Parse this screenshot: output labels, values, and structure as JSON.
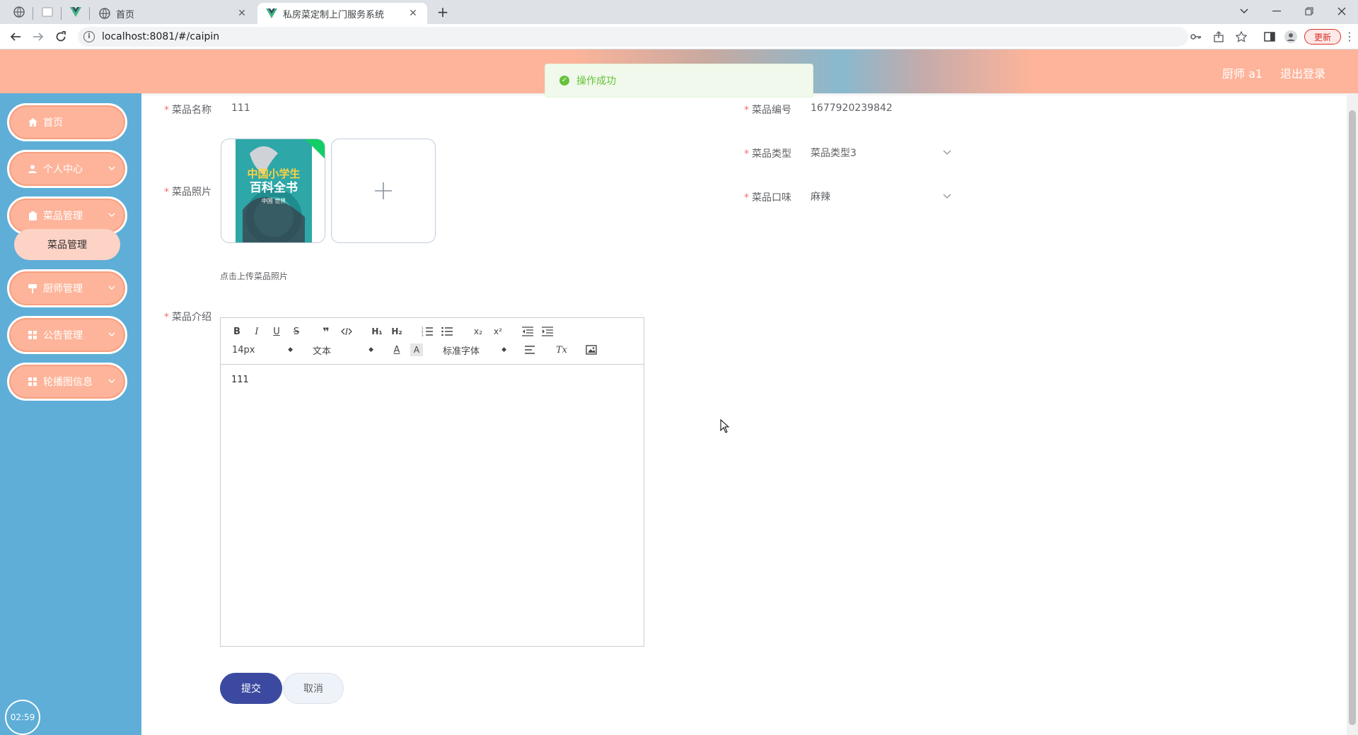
{
  "browser": {
    "tabs": [
      {
        "title": "首页"
      },
      {
        "title": "私房菜定制上门服务系统"
      }
    ],
    "url": "localhost:8081/#/caipin",
    "update_label": "更新"
  },
  "header": {
    "user_label": "厨师 a1",
    "logout_label": "退出登录"
  },
  "toast": {
    "message": "操作成功"
  },
  "sidebar": {
    "items": [
      {
        "label": "首页"
      },
      {
        "label": "个人中心"
      },
      {
        "label": "菜品管理"
      },
      {
        "label": "厨师管理"
      },
      {
        "label": "公告管理"
      },
      {
        "label": "轮播图信息"
      }
    ],
    "submenu": {
      "label": "菜品管理"
    },
    "clock": "02:59"
  },
  "form": {
    "name": {
      "label": "菜品名称",
      "value": "111"
    },
    "code": {
      "label": "菜品编号",
      "value": "1677920239842"
    },
    "type": {
      "label": "菜品类型",
      "value": "菜品类型3"
    },
    "taste": {
      "label": "菜品口味",
      "value": "麻辣"
    },
    "photo": {
      "label": "菜品照片",
      "tip": "点击上传菜品照片",
      "thumb_lines": [
        "中国小学生",
        "百科全书",
        "中国 世界"
      ]
    },
    "intro": {
      "label": "菜品介绍",
      "content": "111",
      "toolbar": {
        "size": "14px",
        "header": "文本",
        "font": "标准字体"
      }
    },
    "submit_label": "提交",
    "cancel_label": "取消"
  },
  "colors": {
    "header_peach": "#fdb49a",
    "sidebar_blue": "#5eaed8",
    "submit_blue": "#3b4aa0",
    "success_green": "#67c23a"
  }
}
